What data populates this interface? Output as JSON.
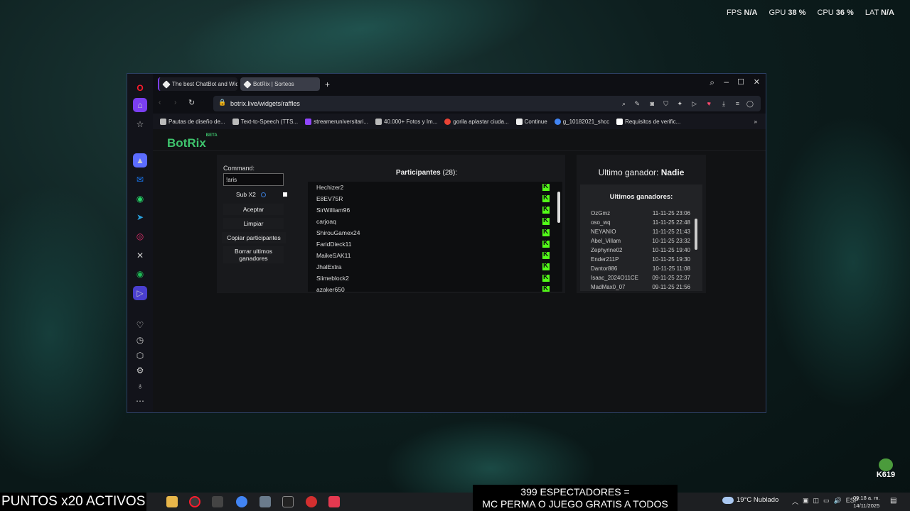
{
  "overlay": {
    "fps_label": "FPS",
    "fps_value": "N/A",
    "gpu_label": "GPU",
    "gpu_value": "38 %",
    "cpu_label": "CPU",
    "cpu_value": "36 %",
    "lat_label": "LAT",
    "lat_value": "N/A"
  },
  "browser": {
    "tabs": [
      "The best ChatBot and Wid",
      "BotRix | Sorteos"
    ],
    "url": "botrix.live/widgets/raffles",
    "bookmarks": [
      "Pautas de diseño de...",
      "Text-to-Speech (TTS...",
      "streameruniversitari...",
      "40.000+ Fotos y Im...",
      "gorila aplastar ciuda...",
      "Continue",
      "g_10182021_shcc",
      "Requisitos de verific..."
    ]
  },
  "page": {
    "logo": "BotRix",
    "logo_badge": "BETA",
    "command_label": "Command:",
    "command_value": "!aris",
    "sub_label": "Sub X2",
    "buttons": [
      "Aceptar",
      "Limpiar",
      "Copiar participantes",
      "Borrar ultimos ganadores"
    ],
    "participants_label": "Participantes",
    "participants_count": "(28):",
    "participants": [
      "Hechizer2",
      "E8EV75R",
      "SirWilliam96",
      "carjoaq",
      "ShirouGamex24",
      "FaridDieck11",
      "MaikeSAK11",
      "JhalExtra",
      "Slimeblock2",
      "azaker650"
    ],
    "last_winner_label": "Ultimo ganador:",
    "last_winner_value": "Nadie",
    "winners_title": "Ultimos ganadores:",
    "winners": [
      {
        "name": "OzGmz",
        "date": "11-11-25 23:06"
      },
      {
        "name": "oso_wq",
        "date": "11-11-25 22:48"
      },
      {
        "name": "NEYANIO",
        "date": "11-11-25 21:43"
      },
      {
        "name": "Abel_Villam",
        "date": "10-11-25 23:32"
      },
      {
        "name": "Zephyrine02",
        "date": "10-11-25 19:40"
      },
      {
        "name": "Ender211P",
        "date": "10-11-25 19:30"
      },
      {
        "name": "Dantor886",
        "date": "10-11-25 11:08"
      },
      {
        "name": "Isaac_2024O11CE",
        "date": "09-11-25 22:37"
      },
      {
        "name": "MadMax0_07",
        "date": "09-11-25 21:56"
      }
    ]
  },
  "stream": {
    "points_banner": "PUNTOS x20 ACTIVOS",
    "viewers_line1": "399 ESPECTADORES =",
    "viewers_line2": "MC PERMA O JUEGO GRATIS A TODOS",
    "badge_text": "K619"
  },
  "taskbar": {
    "weather": "19°C  Nublado",
    "lang": "ESP",
    "time": "09:18 a. m.",
    "date": "14/11/2025"
  }
}
